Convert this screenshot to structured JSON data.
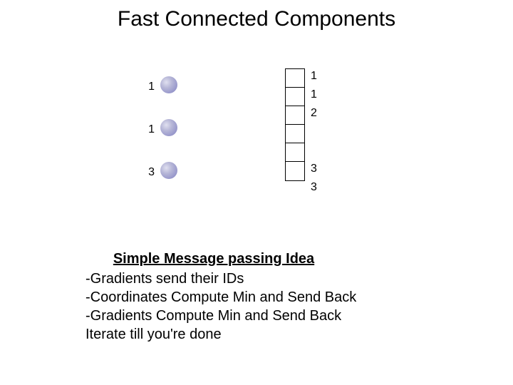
{
  "title": "Fast Connected Components",
  "dots": {
    "labels": [
      "1",
      "1",
      "3"
    ]
  },
  "cells": {
    "count": 6,
    "labels": [
      "1",
      "1",
      "2",
      "",
      "3",
      "3"
    ]
  },
  "text": {
    "heading": "Simple Message passing Idea",
    "lines": [
      "-Gradients send their IDs",
      "-Coordinates Compute Min and Send Back",
      "-Gradients Compute Min and Send Back",
      "Iterate till you're done"
    ]
  }
}
